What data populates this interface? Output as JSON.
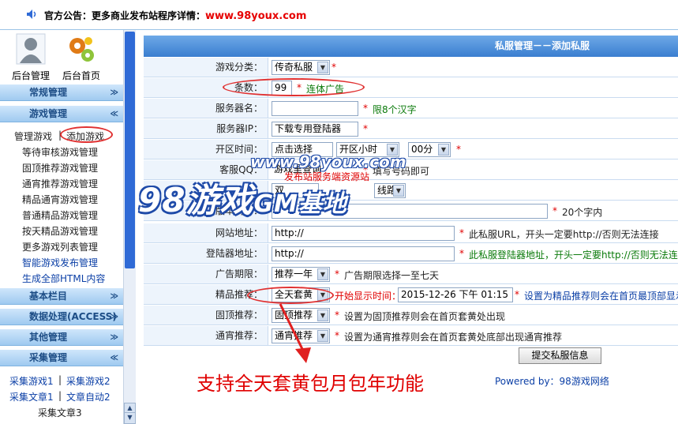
{
  "topbar": {
    "announcement": "官方公告：更多商业发布站程序详情：",
    "url": "www.98youx.com"
  },
  "sidebar": {
    "icons": [
      {
        "label": "后台管理",
        "icon": "admin-user-icon"
      },
      {
        "label": "后台首页",
        "icon": "gears-icon"
      }
    ],
    "sections": [
      {
        "title": "常规管理",
        "chev": "≫"
      },
      {
        "title": "游戏管理",
        "chev": "≪"
      },
      {
        "title": "基本栏目",
        "chev": "≫"
      },
      {
        "title": "数据处理(ACCESS)",
        "chev": "≫"
      },
      {
        "title": "其他管理",
        "chev": "≫"
      },
      {
        "title": "采集管理",
        "chev": "≪"
      }
    ],
    "game_items": {
      "manage": "管理游戏",
      "sep": "|",
      "add": "添加游戏",
      "list": [
        "等待审核游戏管理",
        "固顶推荐游戏管理",
        "通宵推荐游戏管理",
        "精品通宵游戏管理",
        "普通精品游戏管理",
        "按天精品游戏管理",
        "更多游戏列表管理"
      ],
      "smart": "智能游戏发布管理",
      "gen": "生成全部HTML内容"
    },
    "collect_items": {
      "c1": "采集游戏1",
      "sep": "|",
      "c2": "采集游戏2",
      "a1": "采集文章1",
      "a2": "文章自动2",
      "a3": "采集文章3"
    }
  },
  "panel": {
    "title": "私服管理－－添加私服"
  },
  "form": {
    "category": {
      "label": "游戏分类：",
      "value": "传奇私服"
    },
    "count": {
      "label": "条数：",
      "value": "99",
      "hint": "连体广告"
    },
    "server_name": {
      "label": "服务器名：",
      "value": "",
      "hint": "限8个汉字"
    },
    "server_ip": {
      "label": "服务器IP：",
      "value": "下载专用登陆器"
    },
    "open_time": {
      "label": "开区时间：",
      "date": "点击选择",
      "hour": "开区小时",
      "min": "00分"
    },
    "qq": {
      "label": "客服QQ：",
      "value": "游戏里查询",
      "hint": "填写号码即可"
    },
    "line": {
      "label": "区：",
      "value": "双",
      "select": "线路"
    },
    "intro": {
      "label": "版本简介：",
      "value": "",
      "hint": "20个字内"
    },
    "website": {
      "label": "网站地址：",
      "value": "http://",
      "hint": "此私服URL，开头一定要http://否则无法连接"
    },
    "login": {
      "label": "登陆器地址：",
      "value": "http://",
      "hint": "此私服登陆器地址，开头一定要http://否则无法连接"
    },
    "ad_period": {
      "label": "广告期限：",
      "value": "推荐一年",
      "hint": "广告期限选择一至七天"
    },
    "premium": {
      "label": "精品推荐：",
      "value": "全天套黄",
      "start_label": "开始显示时间：",
      "start_value": "2015-12-26 下午 01:15",
      "hint": "设置为精品推荐则会在首页最顶部显示"
    },
    "fixed": {
      "label": "固顶推荐：",
      "value": "固顶推荐",
      "hint": "设置为固顶推荐则会在首页套黄处出现"
    },
    "overnight": {
      "label": "通宵推荐：",
      "value": "通宵推荐",
      "hint": "设置为通宵推荐则会在首页套黄处底部出现通宵推荐"
    },
    "submit": "提交私服信息",
    "star": "*"
  },
  "powered": "Powered by：98游戏网络",
  "watermarks": {
    "site": "www.98youx.com",
    "source": "发布站服务端资源站",
    "brand": "98游戏",
    "brand2": "GM基地"
  },
  "feature_text": "支持全天套黄包月包年功能",
  "colors": {
    "header_blue": "#3a7ed0",
    "sidebar_header": "#9fcaf0",
    "accent_red": "#e00000",
    "link_blue": "#0b3fa6"
  }
}
